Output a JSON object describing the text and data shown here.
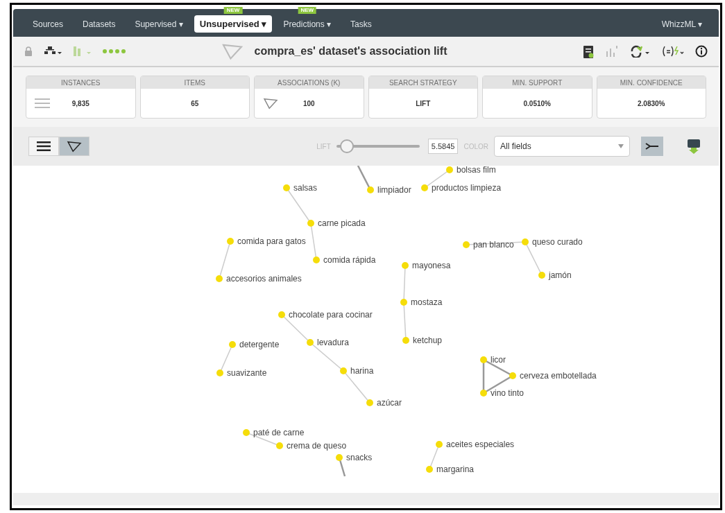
{
  "nav": {
    "items": [
      {
        "label": "Sources",
        "dropdown": false,
        "selected": false
      },
      {
        "label": "Datasets",
        "dropdown": false,
        "selected": false
      },
      {
        "label": "Supervised",
        "dropdown": true,
        "selected": false
      },
      {
        "label": "Unsupervised",
        "dropdown": true,
        "selected": true,
        "badge": "NEW"
      },
      {
        "label": "Predictions",
        "dropdown": true,
        "selected": false,
        "badge": "NEW"
      },
      {
        "label": "Tasks",
        "dropdown": false,
        "selected": false
      }
    ],
    "right": {
      "label": "WhizzML",
      "dropdown": true
    },
    "caret": "▾"
  },
  "toolbar": {
    "title": "compra_es' dataset's association lift"
  },
  "stats": [
    {
      "label": "INSTANCES",
      "value": "9,835"
    },
    {
      "label": "ITEMS",
      "value": "65"
    },
    {
      "label": "ASSOCIATIONS (K)",
      "value": "100"
    },
    {
      "label": "SEARCH STRATEGY",
      "value": "LIFT"
    },
    {
      "label": "MIN. SUPPORT",
      "value": "0.0510%"
    },
    {
      "label": "MIN. CONFIDENCE",
      "value": "2.0830%"
    }
  ],
  "controls": {
    "views": [
      {
        "kind": "list",
        "selected": false
      },
      {
        "kind": "graph",
        "selected": true
      }
    ],
    "lift_label": "LIFT",
    "lift": {
      "level": 0.05
    },
    "lift_value": "5.5845",
    "color_label": "COLOR",
    "color_select": "All fields"
  },
  "graph": {
    "clusters": [
      {
        "items": [
          "limpiador"
        ]
      },
      {
        "items": [
          "bolsas film",
          "productos limpieza"
        ]
      },
      {
        "items": [
          "salsas",
          "carne picada",
          "comida rápida"
        ]
      },
      {
        "items": [
          "comida para gatos",
          "accesorios animales"
        ]
      },
      {
        "items": [
          "pan blanco",
          "queso curado",
          "jamón"
        ]
      },
      {
        "items": [
          "mayonesa",
          "mostaza",
          "ketchup"
        ]
      },
      {
        "items": [
          "detergente",
          "suavizante"
        ]
      },
      {
        "items": [
          "chocolate para cocinar",
          "levadura",
          "harina",
          "azúcar"
        ]
      },
      {
        "items": [
          "licor",
          "cerveza embotellada",
          "vino tinto"
        ]
      },
      {
        "items": [
          "paté de carne",
          "crema de queso"
        ]
      },
      {
        "items": [
          "snacks"
        ]
      },
      {
        "items": [
          "aceites especiales",
          "margarina"
        ]
      }
    ]
  }
}
